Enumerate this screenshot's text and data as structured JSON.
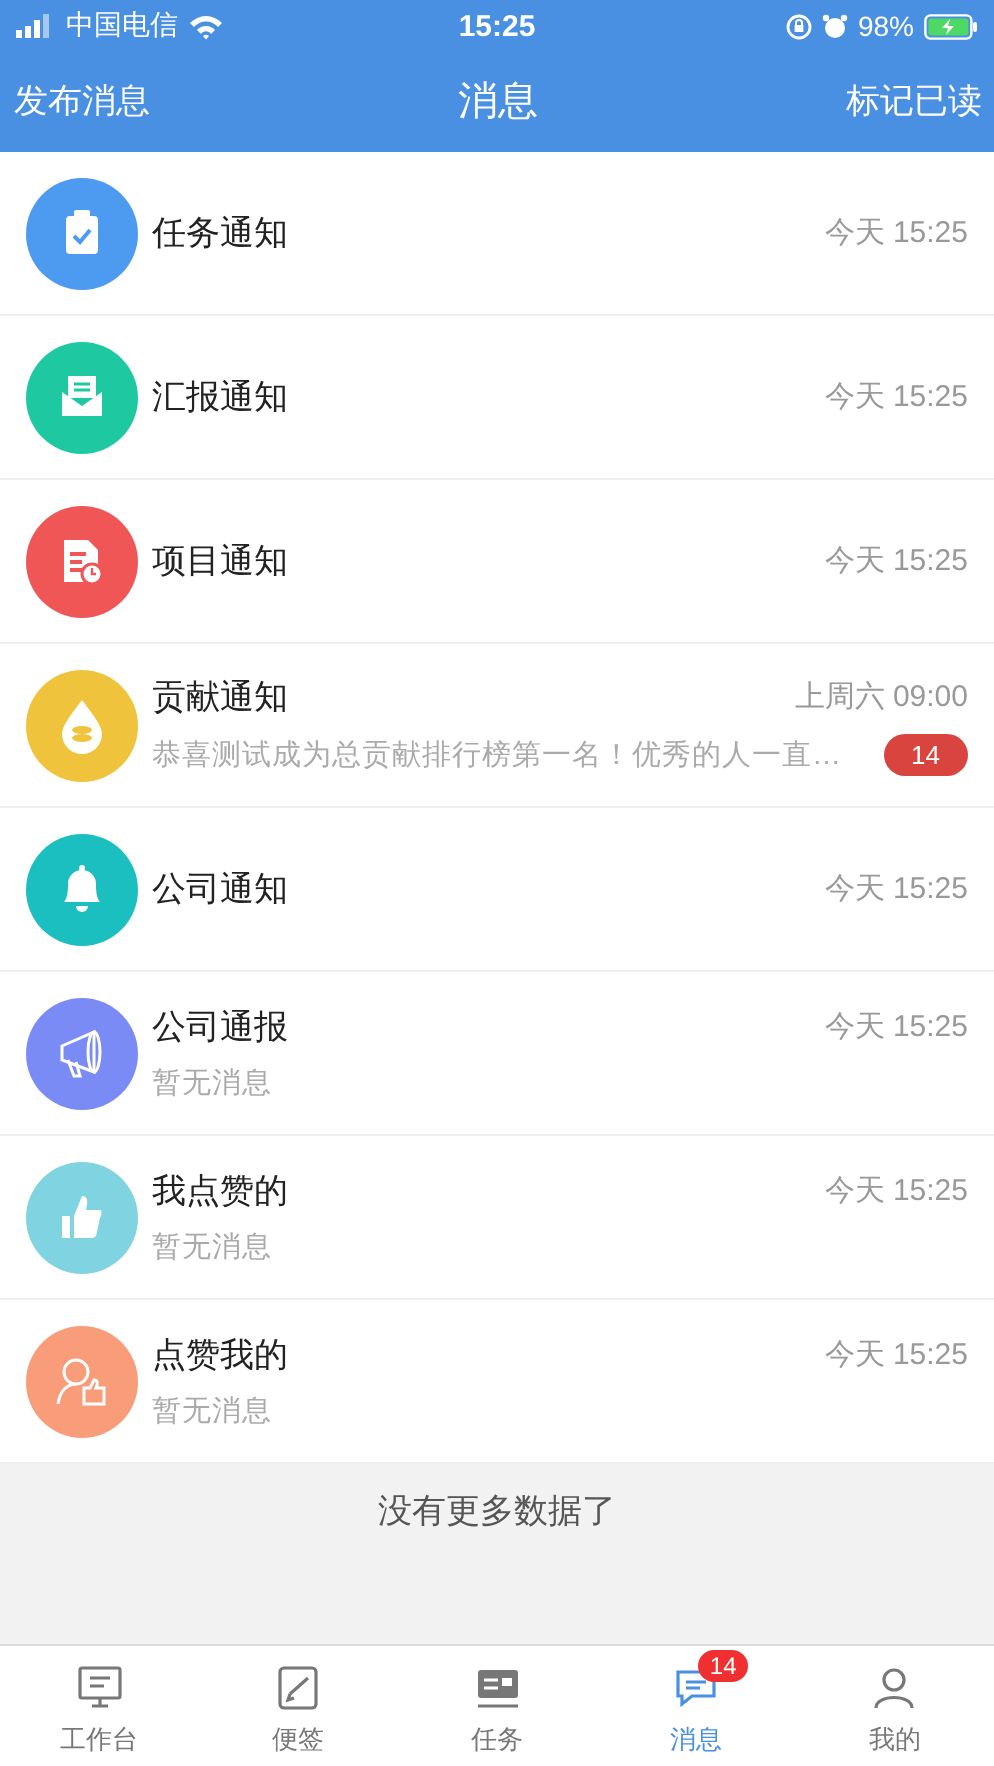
{
  "status_bar": {
    "carrier": "中国电信",
    "time": "15:25",
    "battery": "98%"
  },
  "nav_bar": {
    "left_action": "发布消息",
    "title": "消息",
    "right_action": "标记已读"
  },
  "messages": [
    {
      "title": "任务通知",
      "time": "今天 15:25",
      "color": "#4d9bf0"
    },
    {
      "title": "汇报通知",
      "time": "今天 15:25",
      "color": "#1ec9a2"
    },
    {
      "title": "项目通知",
      "time": "今天 15:25",
      "color": "#f05656"
    },
    {
      "title": "贡献通知",
      "time": "上周六 09:00",
      "preview": "恭喜测试成为总贡献排行榜第一名！优秀的人一直…",
      "badge": "14",
      "color": "#efc43c"
    },
    {
      "title": "公司通知",
      "time": "今天 15:25",
      "color": "#1cbfc0"
    },
    {
      "title": "公司通报",
      "time": "今天 15:25",
      "preview": "暂无消息",
      "color": "#7b8bf6"
    },
    {
      "title": "我点赞的",
      "time": "今天 15:25",
      "preview": "暂无消息",
      "color": "#80d4e2"
    },
    {
      "title": "点赞我的",
      "time": "今天 15:25",
      "preview": "暂无消息",
      "color": "#f99c79"
    }
  ],
  "footer": "没有更多数据了",
  "tabs": [
    {
      "label": "工作台",
      "selected": false
    },
    {
      "label": "便签",
      "selected": false
    },
    {
      "label": "任务",
      "selected": false
    },
    {
      "label": "消息",
      "selected": true,
      "badge": "14"
    },
    {
      "label": "我的",
      "selected": false
    }
  ]
}
